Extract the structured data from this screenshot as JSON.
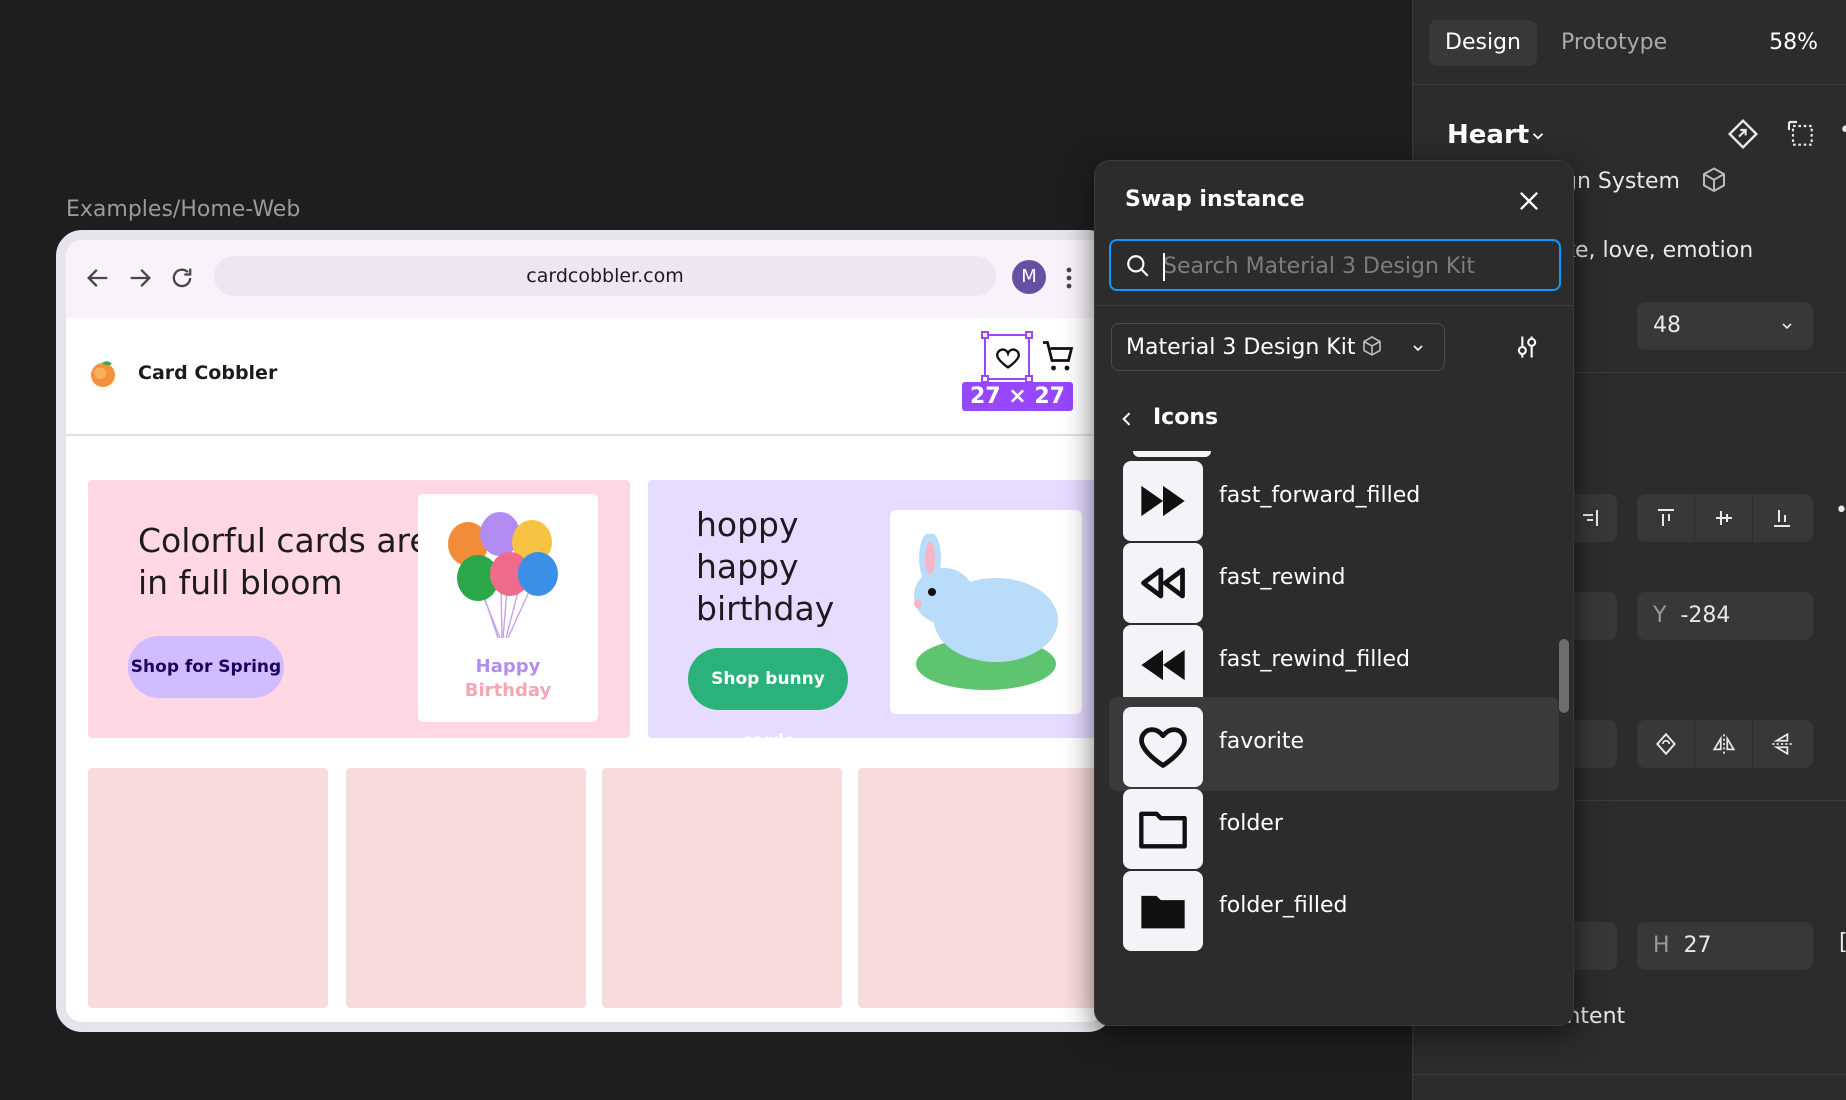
{
  "canvas": {
    "frame_label": "Examples/Home-Web"
  },
  "browser": {
    "url": "cardcobbler.com",
    "avatar_letter": "M"
  },
  "site": {
    "brand": "Card Cobbler",
    "size_badge": "27 × 27",
    "banner1": {
      "title_line1": "Colorful cards are",
      "title_line2": "in full bloom",
      "button": "Shop for Spring",
      "card_line1": "Happy",
      "card_line2": "Birthday"
    },
    "banner2": {
      "title_line1": "hoppy",
      "title_line2": "happy",
      "title_line3": "birthday",
      "button": "Shop bunny cards"
    }
  },
  "panel": {
    "tab_design": "Design",
    "tab_prototype": "Prototype",
    "zoom": "58%",
    "component_name": "Heart",
    "library_fragment": "gn System",
    "description_fragment": "ke, love, emotion",
    "size_value": "48",
    "y_label": "Y",
    "y_value": "-284",
    "h_label": "H",
    "h_value": "27",
    "clip_fragment": "ontent"
  },
  "popover": {
    "title": "Swap instance",
    "search_placeholder": "Search Material 3 Design Kit",
    "library": "Material 3 Design Kit",
    "section": "Icons",
    "items": [
      {
        "name": "fast_forward_filled",
        "icon": "fast-forward-filled-icon"
      },
      {
        "name": "fast_rewind",
        "icon": "fast-rewind-icon"
      },
      {
        "name": "fast_rewind_filled",
        "icon": "fast-rewind-filled-icon"
      },
      {
        "name": "favorite",
        "icon": "favorite-icon",
        "selected": true
      },
      {
        "name": "folder",
        "icon": "folder-icon"
      },
      {
        "name": "folder_filled",
        "icon": "folder-filled-icon"
      }
    ]
  },
  "colors": {
    "selection": "#9747ff",
    "focus": "#0d99ff",
    "panel_bg": "#2c2c2c",
    "canvas_bg": "#1e1e1e",
    "banner_pink": "#ffd8e4",
    "banner_lavender": "#e6dcff",
    "button_green": "#2bb27a",
    "button_purple": "#d0bcff"
  }
}
